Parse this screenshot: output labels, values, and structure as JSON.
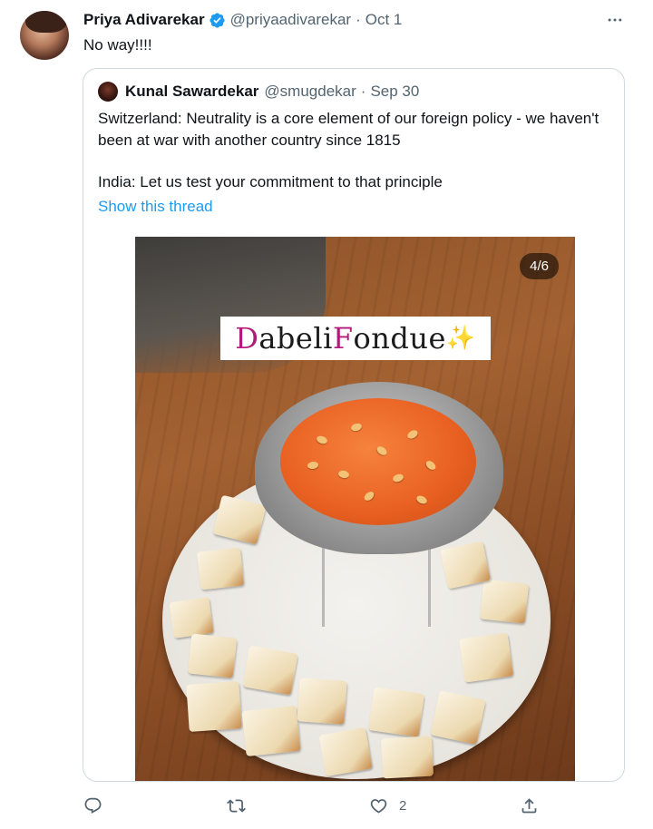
{
  "tweet": {
    "author_name": "Priya Adivarekar",
    "author_handle": "@priyaadivarekar",
    "separator": "·",
    "date": "Oct 1",
    "text": "No way!!!!"
  },
  "quoted": {
    "author_name": "Kunal Sawardekar",
    "author_handle": "@smugdekar",
    "separator": "·",
    "date": "Sep 30",
    "text_line1": "Switzerland: Neutrality is a core element of our foreign policy - we haven't been at war with another country since 1815",
    "text_line2": "India: Let us test your commitment to that principle",
    "show_thread": "Show this thread",
    "media": {
      "counter": "4/6",
      "caption_letter1": "D",
      "caption_part1": "abeli ",
      "caption_letter2": "F",
      "caption_part2": "ondue",
      "caption_sparkle": "✨"
    }
  },
  "actions": {
    "reply_icon": "reply-icon",
    "retweet_icon": "retweet-icon",
    "like_icon": "heart-icon",
    "like_count": "2",
    "share_icon": "share-icon"
  },
  "colors": {
    "link": "#1d9bf0",
    "verified": "#1d9bf0",
    "secondary_text": "#536471",
    "border": "#cfd9de",
    "caption_accent": "#b01a7a"
  }
}
